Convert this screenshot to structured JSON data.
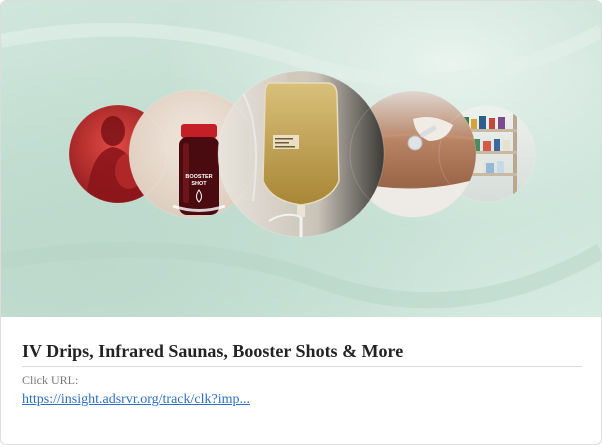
{
  "ad": {
    "title": "IV Drips, Infrared Saunas, Booster Shots & More",
    "click_label": "Click URL:",
    "click_url": "https://insight.adsrvr.org/track/clk?imp..."
  },
  "hero": {
    "bottle_label_line1": "BOOSTER",
    "bottle_label_line2": "SHOT",
    "accent_colors": {
      "background": "#c9e2d6",
      "sauna_red": "#b7282b",
      "bottle_red": "#5a0e12",
      "iv_fluid": "#c4a45a"
    }
  }
}
